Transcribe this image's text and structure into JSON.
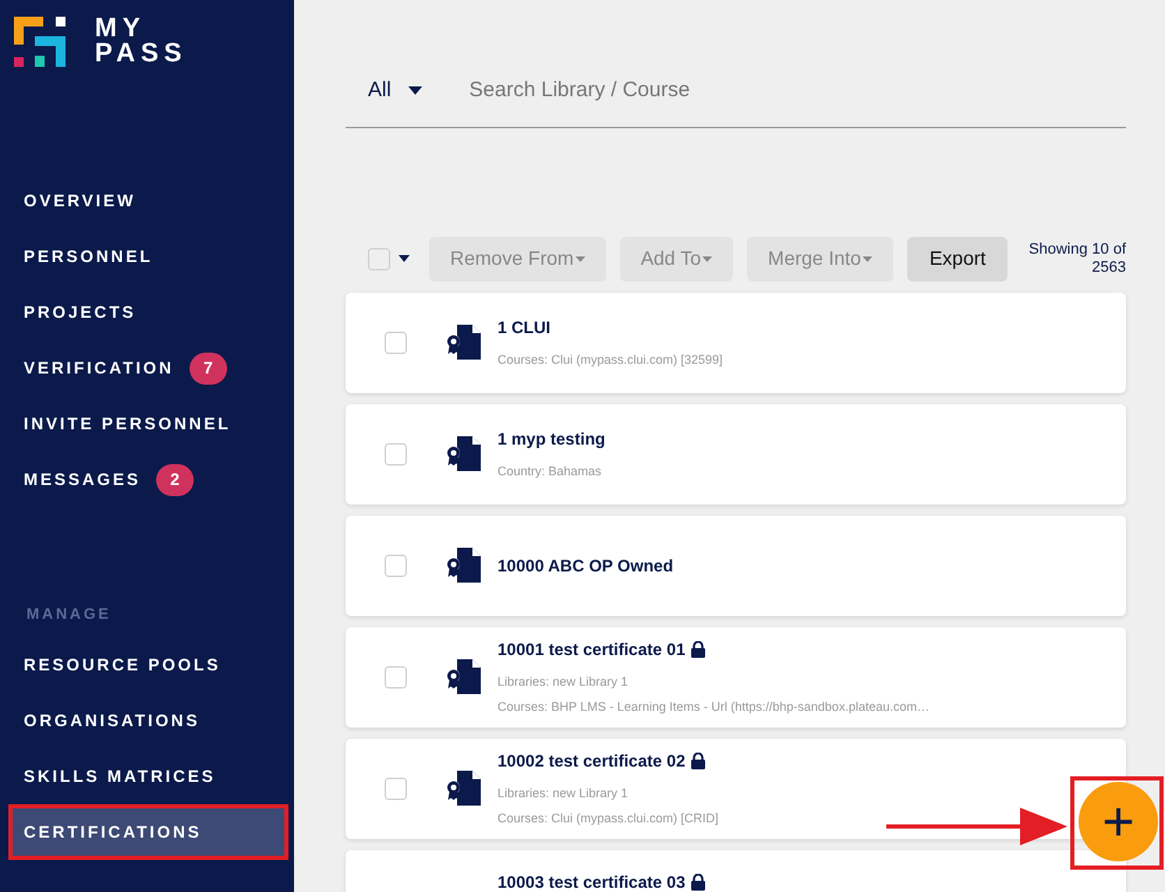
{
  "logo": {
    "line_1": "MY",
    "line_2": "PASS"
  },
  "nav": [
    {
      "label": "OVERVIEW",
      "selected": false
    },
    {
      "label": "PERSONNEL",
      "selected": false
    },
    {
      "label": "PROJECTS",
      "selected": false
    },
    {
      "label": "VERIFICATION",
      "badge": "7",
      "selected": false
    },
    {
      "label": "INVITE PERSONNEL",
      "selected": false
    },
    {
      "label": "MESSAGES",
      "badge": "2",
      "selected": false
    }
  ],
  "manage": {
    "heading": "MANAGE",
    "items": [
      {
        "label": "RESOURCE POOLS",
        "selected": false
      },
      {
        "label": "ORGANISATIONS",
        "selected": false
      },
      {
        "label": "SKILLS MATRICES",
        "selected": false
      },
      {
        "label": "CERTIFICATIONS",
        "selected": true
      }
    ]
  },
  "filter": {
    "value": "All"
  },
  "search": {
    "placeholder": "Search Library / Course"
  },
  "toolbar": {
    "select_all_checked": false,
    "buttons": [
      {
        "label": "Remove From",
        "dropdown": true,
        "disabled": true
      },
      {
        "label": "Add To",
        "dropdown": true,
        "disabled": true
      },
      {
        "label": "Merge Into",
        "dropdown": true,
        "disabled": true
      },
      {
        "label": "Export",
        "dropdown": false,
        "disabled": false
      }
    ],
    "showing": "Showing 10 of 2563"
  },
  "rows": [
    {
      "title": "1 CLUI",
      "locked": false,
      "checked": false,
      "details": [
        "Courses: Clui (mypass.clui.com) [32599]"
      ]
    },
    {
      "title": "1 myp testing",
      "locked": false,
      "checked": false,
      "details": [
        "Country: Bahamas"
      ]
    },
    {
      "title": "10000 ABC OP Owned",
      "locked": false,
      "checked": false,
      "details": []
    },
    {
      "title": "10001 test certificate 01",
      "locked": true,
      "checked": false,
      "details": [
        "Libraries: new Library 1",
        "Courses: BHP LMS - Learning Items - Url (https://bhp-sandbox.plateau.com…"
      ]
    },
    {
      "title": "10002 test certificate 02",
      "locked": true,
      "checked": false,
      "details": [
        "Libraries: new Library 1",
        "Courses: Clui (mypass.clui.com) [CRID]"
      ]
    },
    {
      "title": "10003 test certificate 03",
      "locked": true,
      "details": []
    }
  ],
  "fab": {
    "label": "+"
  }
}
